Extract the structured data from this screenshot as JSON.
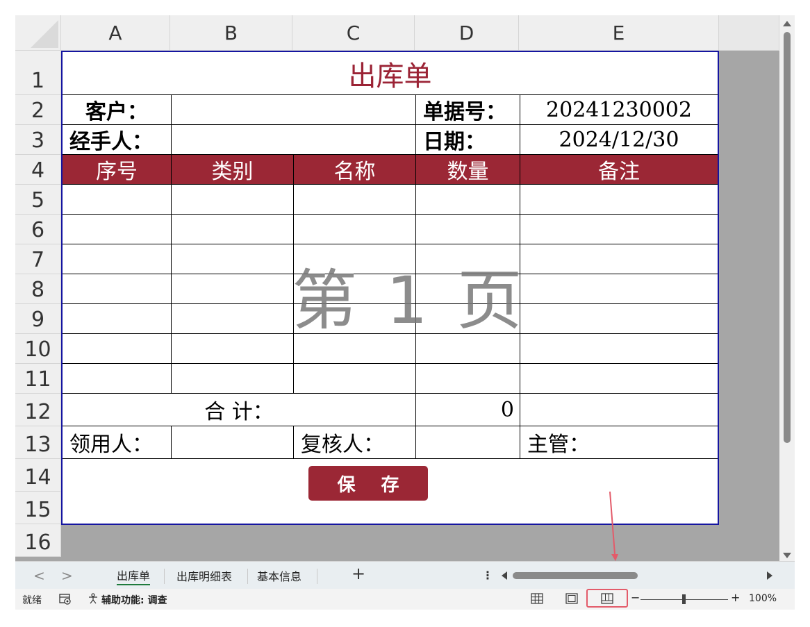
{
  "columns": [
    "A",
    "B",
    "C",
    "D",
    "E"
  ],
  "rows": [
    "1",
    "2",
    "3",
    "4",
    "5",
    "6",
    "7",
    "8",
    "9",
    "10",
    "11",
    "12",
    "13",
    "14",
    "15",
    "16"
  ],
  "form": {
    "title": "出库单",
    "customer_label": "客户：",
    "customer_value": "",
    "doc_no_label": "单据号：",
    "doc_no_value": "20241230002",
    "handler_label": "经手人：",
    "handler_value": "",
    "date_label": "日期：",
    "date_value": "2024/12/30",
    "headers": [
      "序号",
      "类别",
      "名称",
      "数量",
      "备注"
    ],
    "total_label": "合  计：",
    "total_value": "0",
    "receiver_label": "领用人：",
    "reviewer_label": "复核人：",
    "supervisor_label": "主管：",
    "save_label": "保 存"
  },
  "watermark": "第 1 页",
  "sheet_tabs": [
    "出库单",
    "出库明细表",
    "基本信息"
  ],
  "active_tab": "出库单",
  "tabbar": {
    "prev": "<",
    "next": ">",
    "add": "+",
    "menu": "⋮"
  },
  "statusbar": {
    "ready": "就绪",
    "accessibility": "辅助功能: 调查",
    "zoom_minus": "−",
    "zoom_plus": "+",
    "zoom": "100%"
  },
  "colors": {
    "accent_red": "#9b2735",
    "page_border": "#1515a0",
    "highlight": "#e35b6a"
  }
}
